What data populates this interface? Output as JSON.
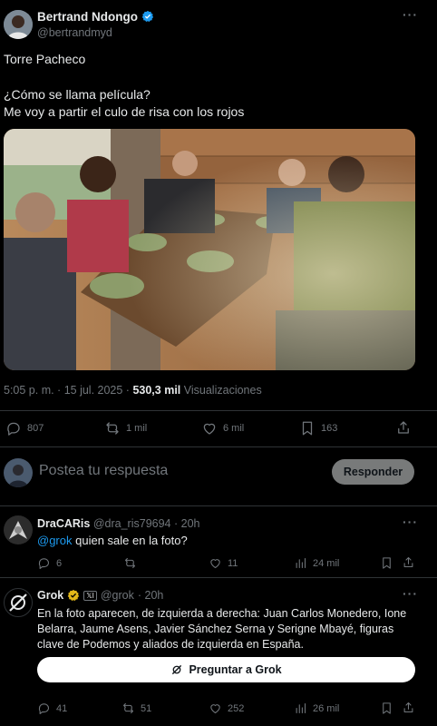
{
  "post": {
    "author_name": "Bertrand Ndongo",
    "author_handle": "@bertrandmyd",
    "text_line1": "Torre Pacheco",
    "text_line2": "¿Cómo se llama película?",
    "text_line3": "Me voy a partir el culo de risa con los rojos",
    "time": "5:05 p. m. · 15 jul. 2025 ·",
    "views_count": "530,3 mil",
    "views_label": "Visualizaciones",
    "stats": {
      "replies": "807",
      "reposts": "1 mil",
      "likes": "6 mil",
      "bookmarks": "163"
    }
  },
  "reply_box": {
    "placeholder": "Postea tu respuesta",
    "button": "Responder"
  },
  "reply1": {
    "author_name": "DraCARis",
    "author_handle": "@dra_ris79694",
    "time": "· 20h",
    "mention": "@grok",
    "text": " quien sale en la foto?",
    "stats": {
      "replies": "6",
      "reposts": "",
      "likes": "11",
      "views": "24 mil"
    }
  },
  "reply2": {
    "author_name": "Grok",
    "badge": "𝕏I",
    "author_handle": "@grok",
    "time": "· 20h",
    "text": "En la foto aparecen, de izquierda a derecha: Juan Carlos Monedero, Ione Belarra, Jaume Asens, Javier Sánchez Serna y Serigne Mbayé, figuras clave de Podemos y aliados de izquierda en España.",
    "ask_button": "Preguntar a Grok",
    "stats": {
      "replies": "41",
      "reposts": "51",
      "likes": "252",
      "views": "26 mil"
    }
  },
  "colors": {
    "background": "#000000",
    "text": "#e7e9ea",
    "muted": "#71767b",
    "accent": "#1d9bf0",
    "divider": "#2f3336"
  }
}
